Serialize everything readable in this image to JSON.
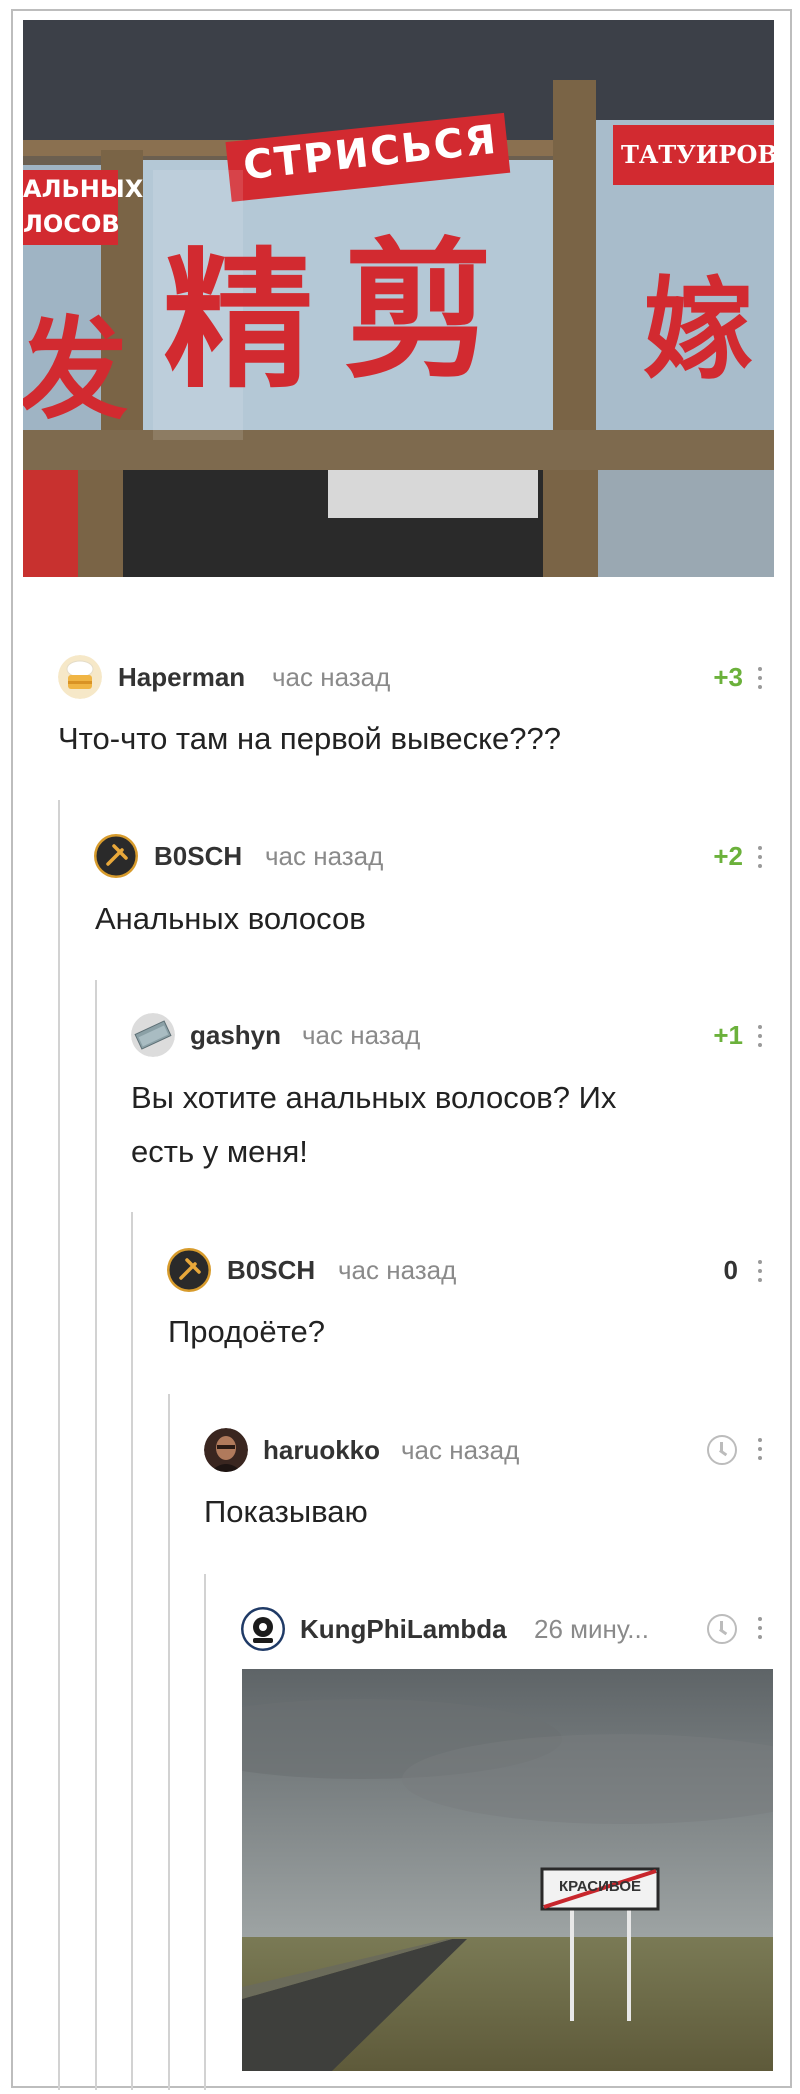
{
  "post_image": {
    "sign_top": "СТРИСЬСЯ",
    "sign_left": [
      "АЛЬНЫХ",
      "ЛОСОВ"
    ],
    "sign_right": "ТАТУИРОВКА",
    "glyph_left": "发",
    "glyph_main_1": "精",
    "glyph_main_2": "剪",
    "glyph_right": "嫁"
  },
  "comments": [
    {
      "user": "Haperman",
      "time": "час назад",
      "rating": "+3",
      "text": "Что-что там на первой вывеске???"
    },
    {
      "user": "B0SCH",
      "time": "час назад",
      "rating": "+2",
      "text": "Анальных волосов"
    },
    {
      "user": "gashyn",
      "time": "час назад",
      "rating": "+1",
      "text_line1": "Вы хотите анальных волосов? Их",
      "text_line2": "есть у меня!"
    },
    {
      "user": "B0SCH",
      "time": "час назад",
      "rating": "0",
      "text": "Продоёте?"
    },
    {
      "user": "haruokko",
      "time": "час назад",
      "rating_icon": "clock-icon",
      "text": "Показываю"
    },
    {
      "user": "KungPhiLambda",
      "time": "26 мину...",
      "rating_icon": "clock-icon",
      "sign_text": "КРАСИВОЕ"
    }
  ],
  "colors": {
    "positive_rating": "#6bb13b",
    "thread_line": "#d2d2d2",
    "sign_red": "#d22a30"
  }
}
